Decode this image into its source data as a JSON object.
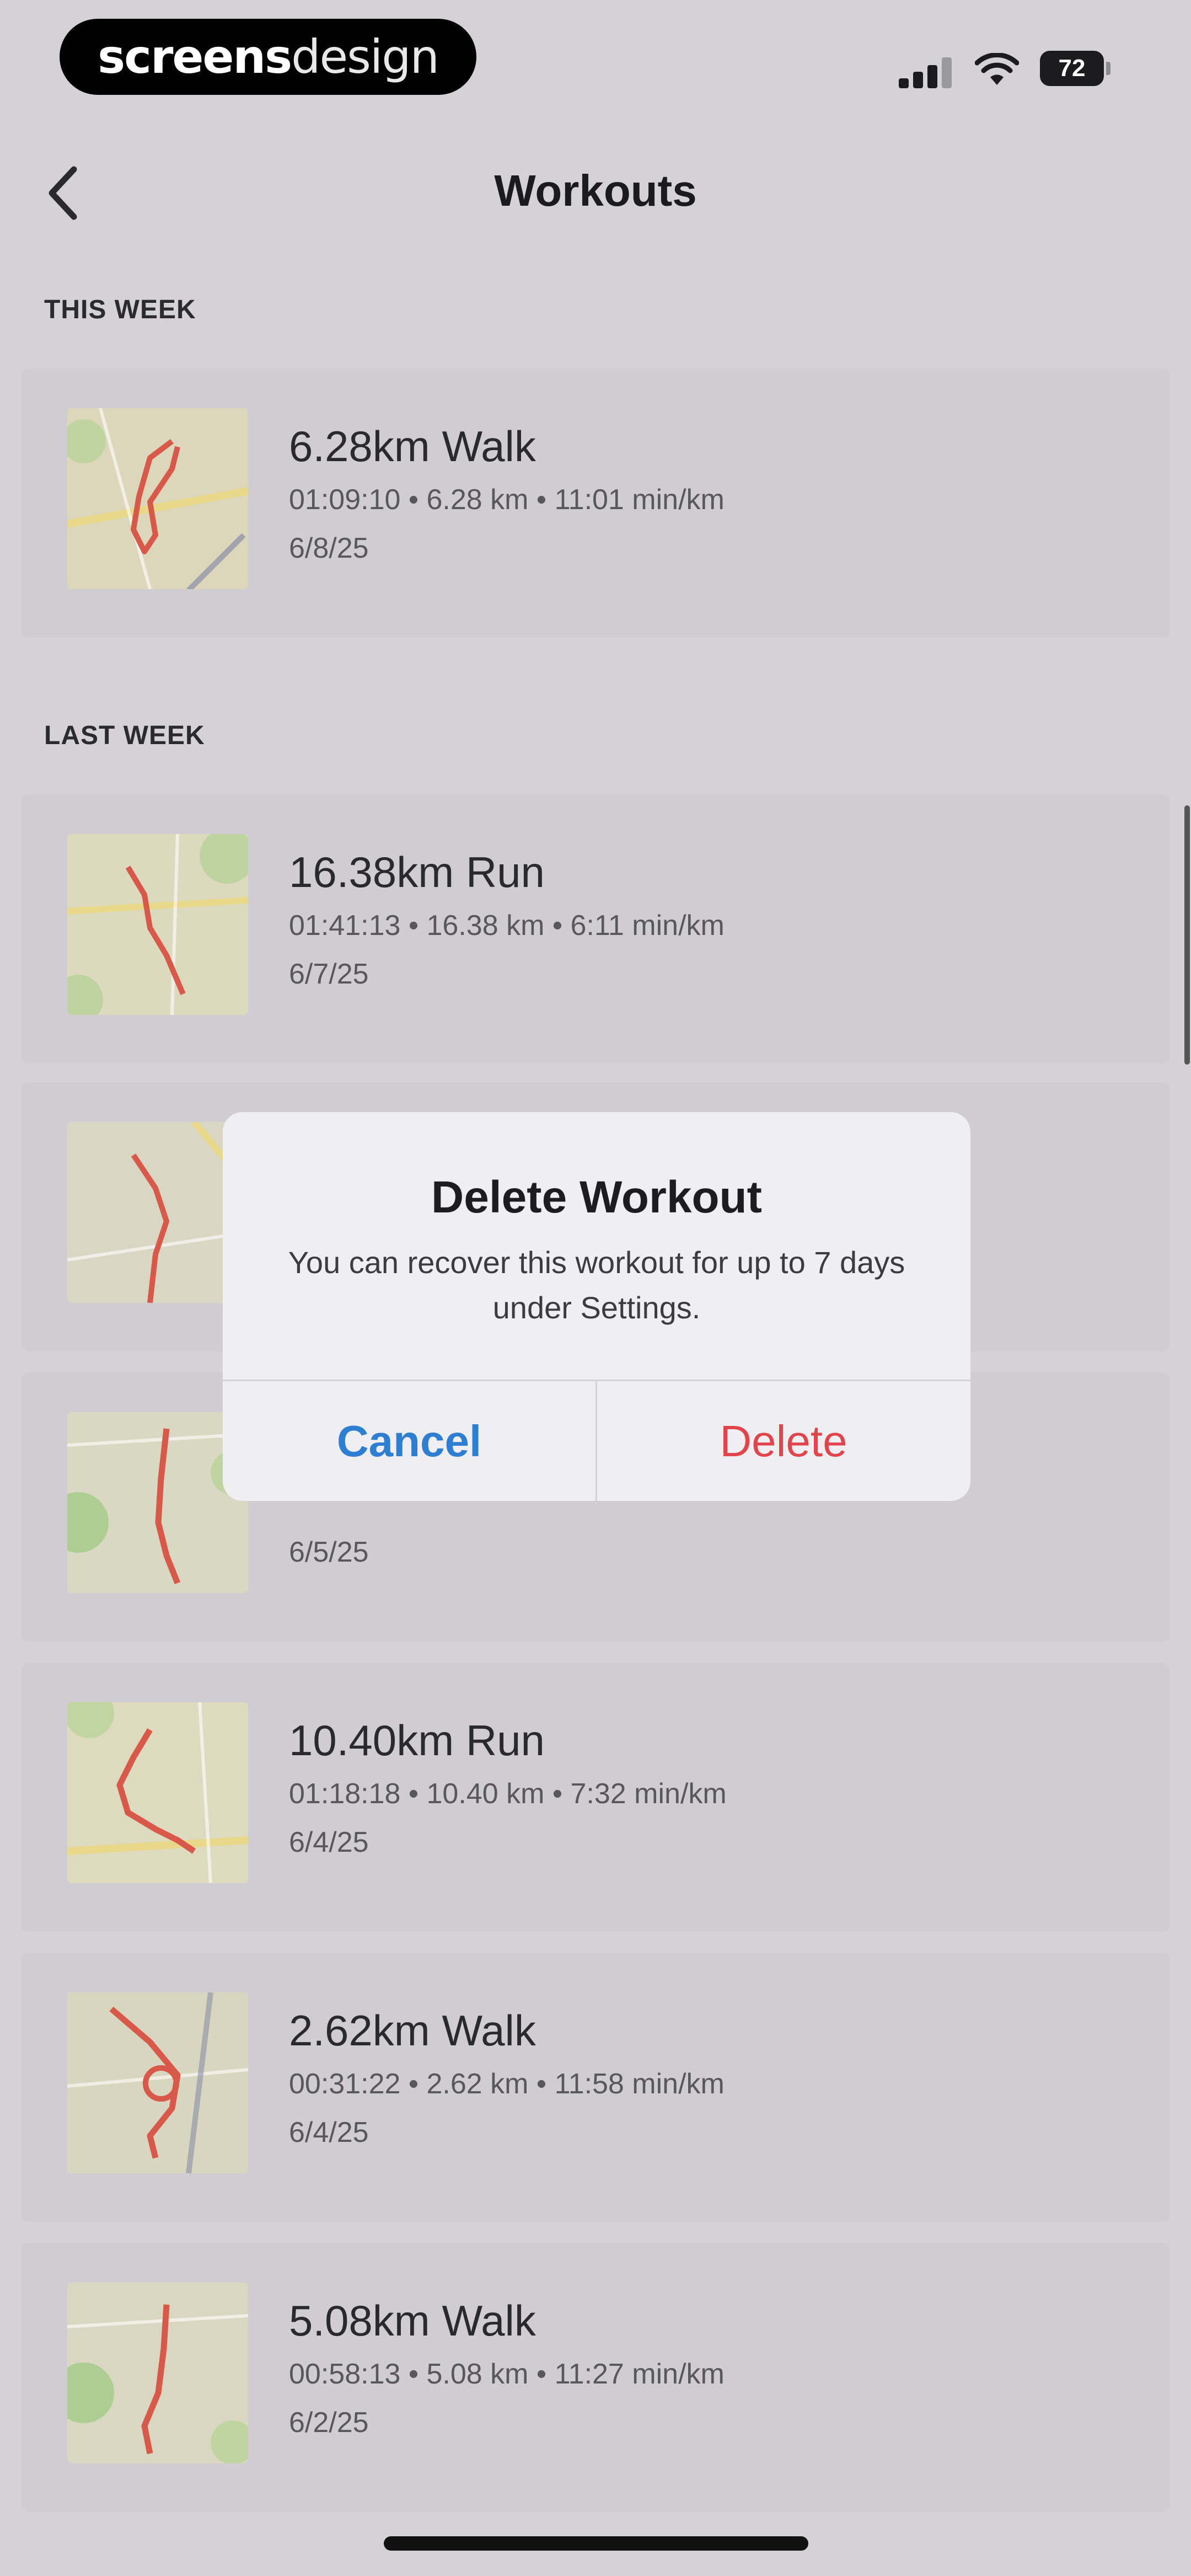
{
  "brand": {
    "bold": "screens",
    "light": "design"
  },
  "status": {
    "battery": "72"
  },
  "nav": {
    "title": "Workouts"
  },
  "sections": [
    {
      "label": "THIS WEEK"
    },
    {
      "label": "LAST WEEK"
    }
  ],
  "workouts": [
    {
      "title": "6.28km Walk",
      "stats": "01:09:10 • 6.28 km • 11:01 min/km",
      "date": "6/8/25"
    },
    {
      "title": "16.38km Run",
      "stats": "01:41:13 • 16.38 km • 6:11 min/km",
      "date": "6/7/25"
    },
    {
      "title": "",
      "stats": "",
      "date": ""
    },
    {
      "title": "",
      "stats": "",
      "date": "6/5/25"
    },
    {
      "title": "10.40km Run",
      "stats": "01:18:18 • 10.40 km • 7:32 min/km",
      "date": "6/4/25"
    },
    {
      "title": "2.62km Walk",
      "stats": "00:31:22 • 2.62 km • 11:58 min/km",
      "date": "6/4/25"
    },
    {
      "title": "5.08km Walk",
      "stats": "00:58:13 • 5.08 km • 11:27 min/km",
      "date": "6/2/25"
    }
  ],
  "alert": {
    "title": "Delete Workout",
    "message": "You can recover this workout for up to 7 days under Settings.",
    "cancel": "Cancel",
    "delete": "Delete"
  },
  "colors": {
    "accent_blue": "#2e7fd1",
    "destructive_red": "#e2444d",
    "route": "#d8584a"
  }
}
